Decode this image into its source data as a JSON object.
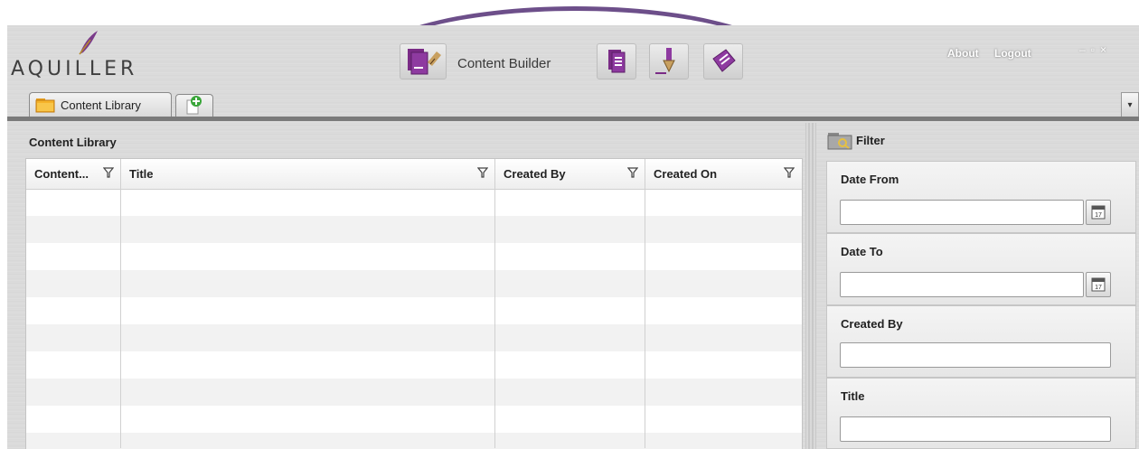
{
  "app": {
    "logo_text": "AQUILLER",
    "top_links": {
      "about": "About",
      "logout": "Logout"
    },
    "window_controls": {
      "minimize": "–",
      "restore": "▫",
      "close": "×"
    }
  },
  "toolbar": {
    "content_builder_label": "Content Builder",
    "buttons": [
      {
        "icon": "content-builder-icon"
      },
      {
        "icon": "documents-icon"
      },
      {
        "icon": "pen-nib-icon"
      },
      {
        "icon": "edit-document-icon"
      }
    ],
    "accent_color": "#7a2b86"
  },
  "tabs": {
    "active_label": "Content Library",
    "new_tab_icon": "add-document-icon",
    "overflow_icon": "▾"
  },
  "library": {
    "panel_title": "Content Library",
    "columns": [
      "Content...",
      "Title",
      "Created By",
      "Created On"
    ],
    "rows": []
  },
  "filter": {
    "title": "Filter",
    "fields": [
      {
        "label": "Date From",
        "value": "",
        "has_calendar": true,
        "calendar_day": "17"
      },
      {
        "label": "Date To",
        "value": "",
        "has_calendar": true,
        "calendar_day": "17"
      },
      {
        "label": "Created By",
        "value": "",
        "has_calendar": false
      },
      {
        "label": "Title",
        "value": "",
        "has_calendar": false
      }
    ]
  },
  "annotation_color": "#6d4f8a"
}
